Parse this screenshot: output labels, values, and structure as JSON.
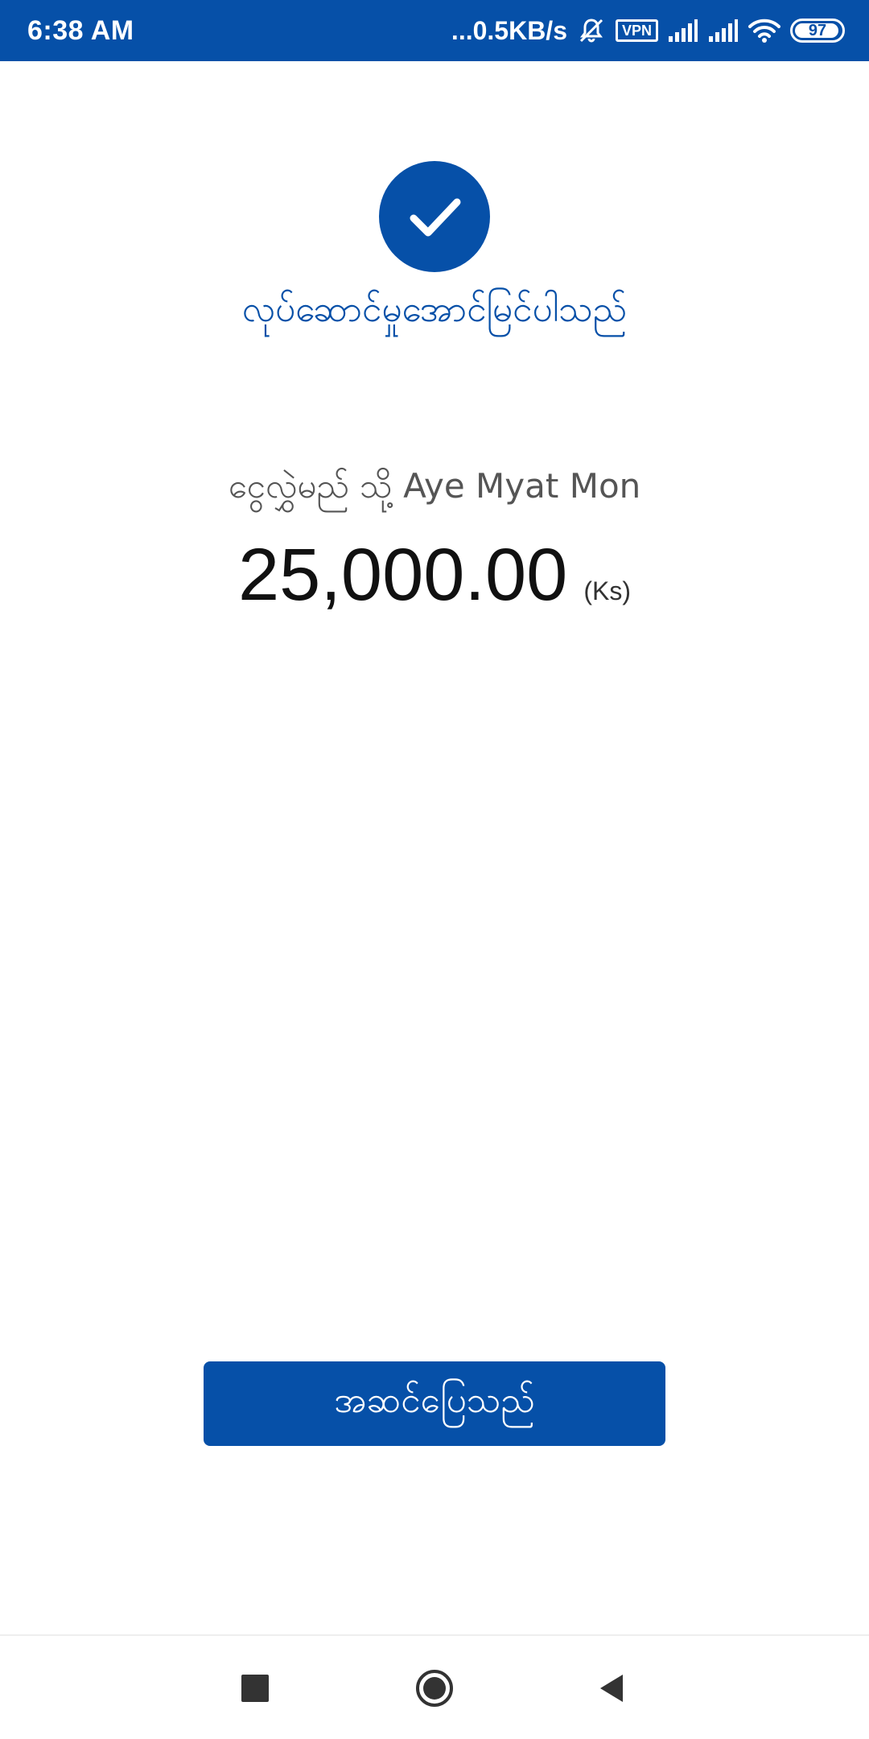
{
  "status_bar": {
    "time": "6:38 AM",
    "network_speed": "...0.5KB/s",
    "vpn_label": "VPN",
    "battery_level": "97",
    "icons": [
      "mute-icon",
      "vpn-icon",
      "signal-icon",
      "signal-icon",
      "wifi-icon",
      "battery-icon"
    ]
  },
  "result": {
    "status_icon": "check-icon",
    "status_text": "လုပ်ဆောင်မှုအောင်မြင်ပါသည်",
    "recipient_prefix": "ငွေလွှဲမည် သို့",
    "recipient_name": "Aye Myat Mon",
    "amount": "25,000.00",
    "currency": "(Ks)"
  },
  "actions": {
    "done_label": "အဆင်ပြေသည်"
  },
  "nav_bar": {
    "icons": [
      "recent-apps-icon",
      "home-icon",
      "back-icon"
    ]
  },
  "colors": {
    "brand": "#0650a8",
    "text_dark": "#111111",
    "text_muted": "#555555"
  }
}
